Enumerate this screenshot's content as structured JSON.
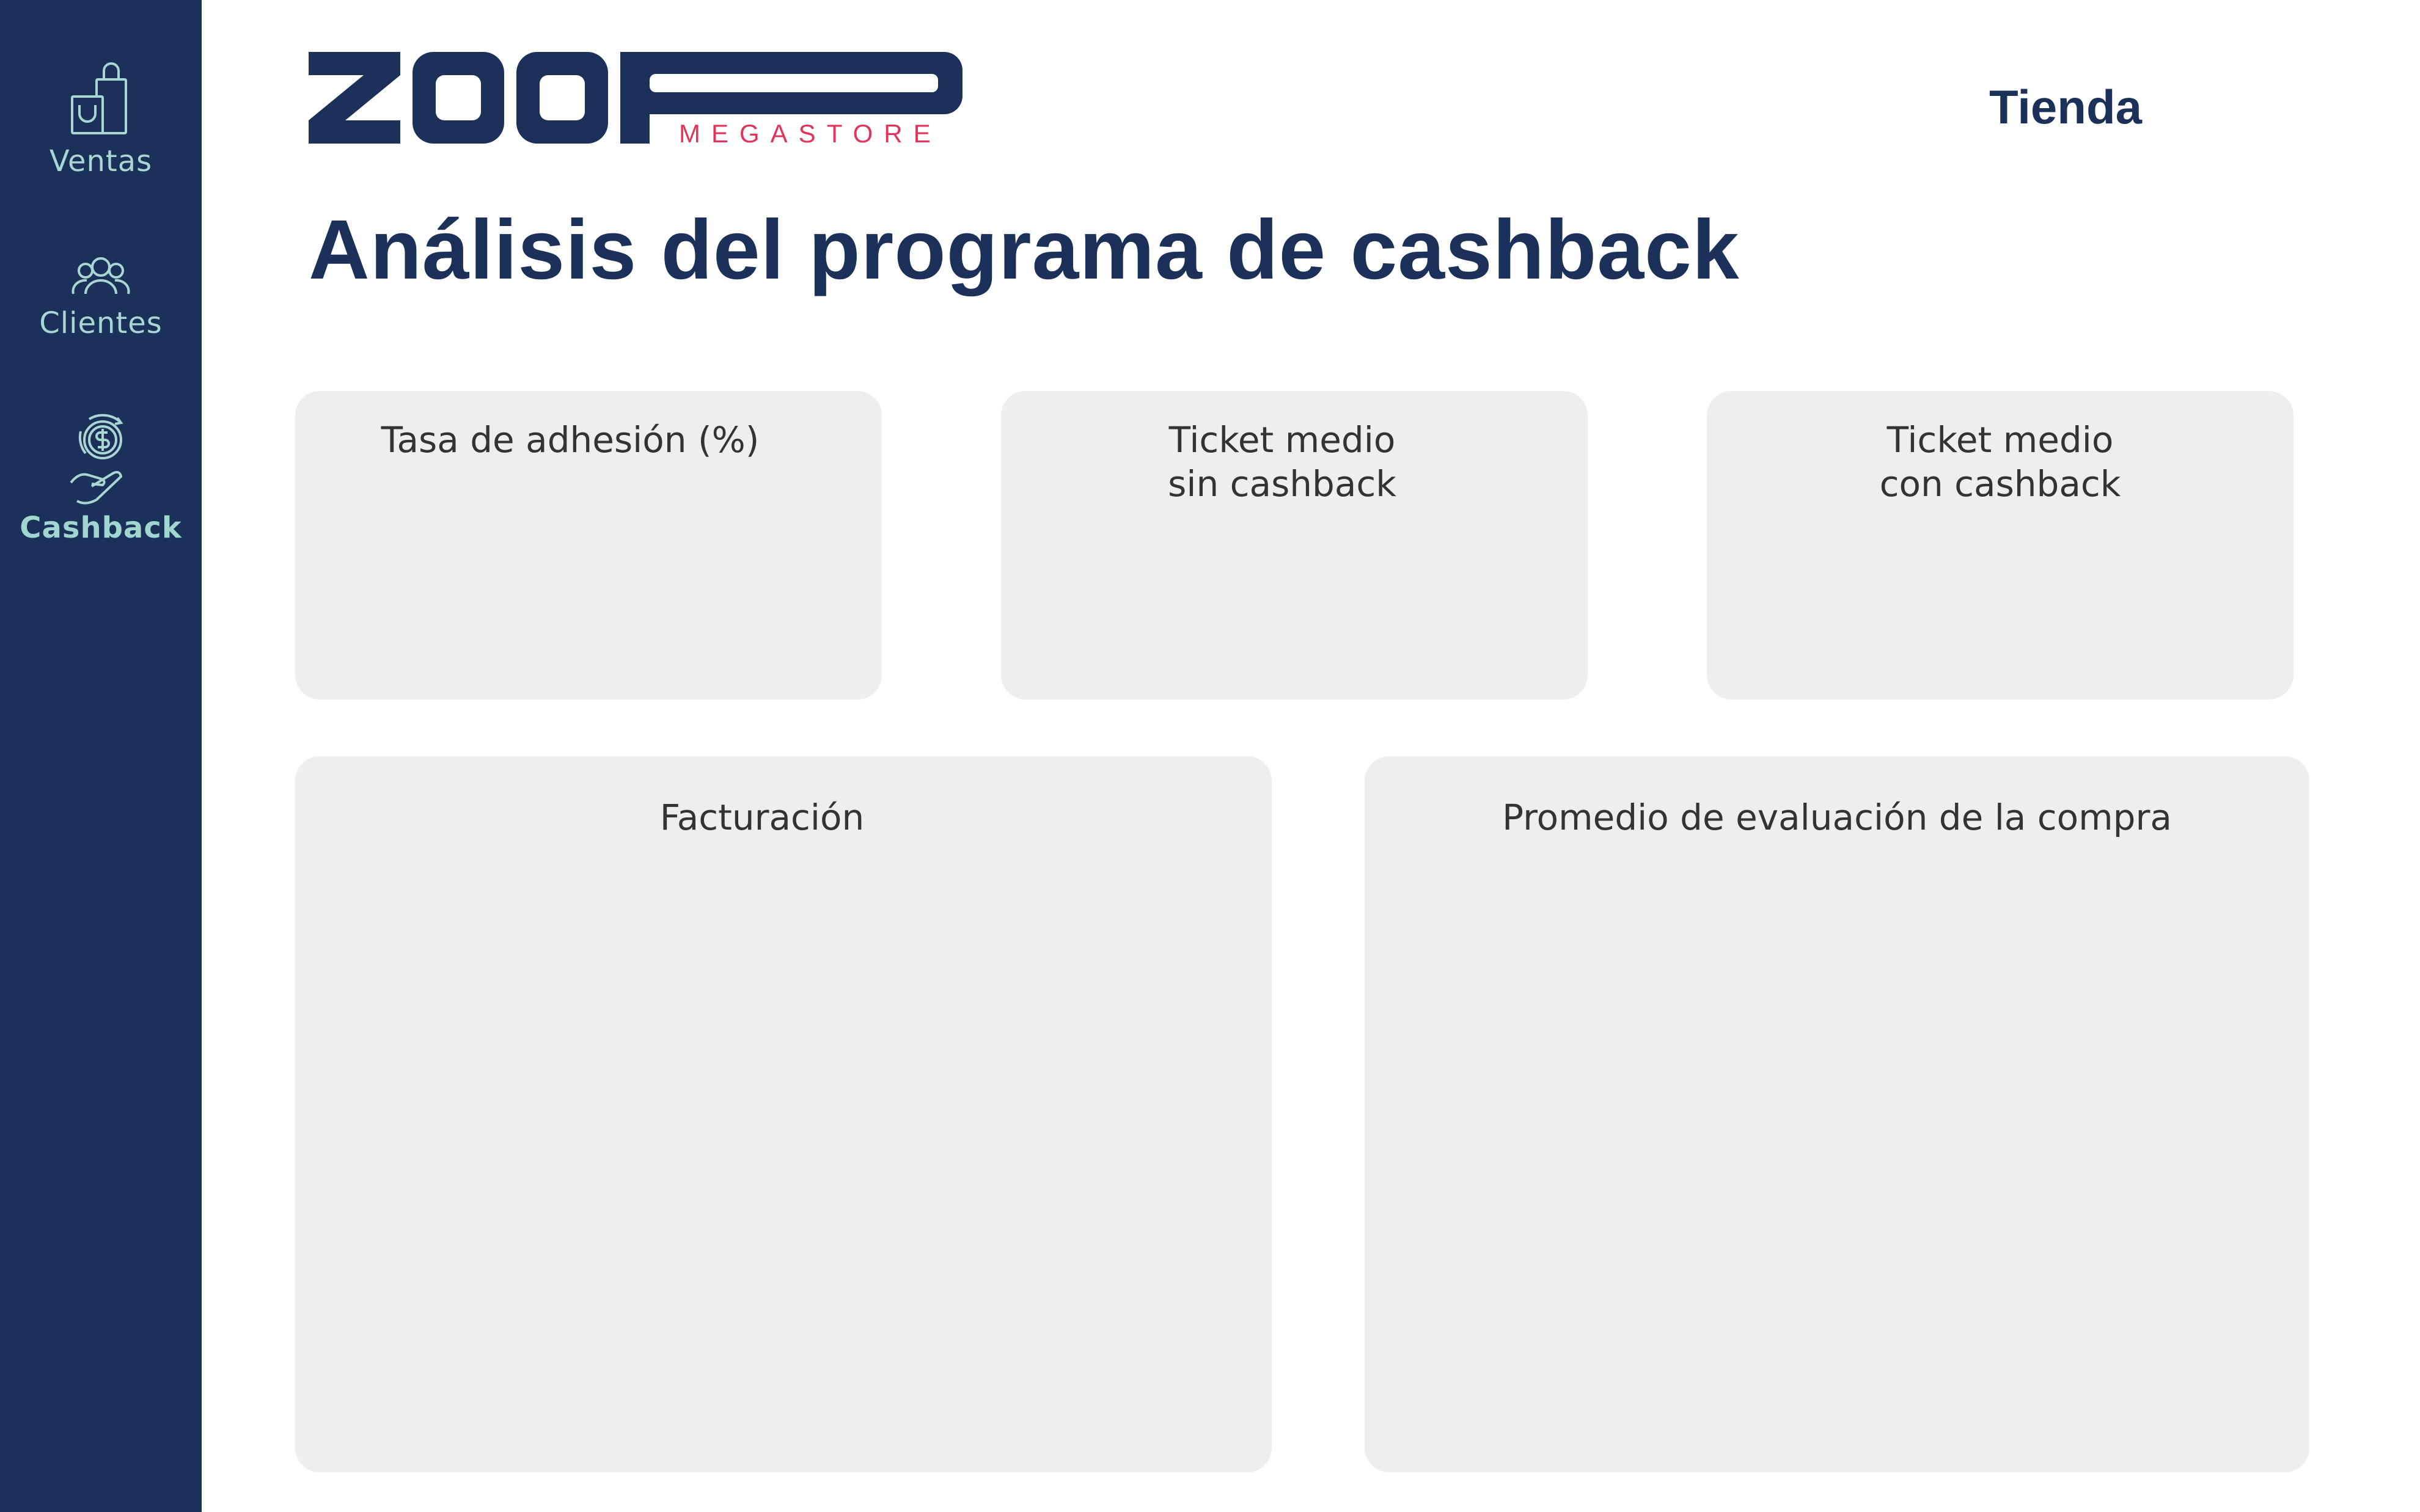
{
  "sidebar": {
    "items": [
      {
        "label": "Ventas",
        "icon": "shopping-bags-icon",
        "active": false
      },
      {
        "label": "Clientes",
        "icon": "users-group-icon",
        "active": false
      },
      {
        "label": "Cashback",
        "icon": "hand-coin-icon",
        "active": true
      }
    ]
  },
  "header": {
    "logo": {
      "wordmark": "ZOOP",
      "tagline": "MEGASTORE"
    },
    "store_label": "Tienda",
    "title": "Análisis del programa de cashback"
  },
  "kpis": [
    {
      "title": "Tasa de adhesión (%)"
    },
    {
      "title": "Ticket medio\nsin cashback"
    },
    {
      "title": "Ticket medio\ncon cashback"
    }
  ],
  "panels": [
    {
      "title": "Facturación"
    },
    {
      "title": "Promedio de evaluación de la compra"
    }
  ],
  "colors": {
    "sidebar_bg": "#1b3159",
    "sidebar_text": "#a9d6d3",
    "brand_navy": "#1b3159",
    "brand_accent": "#e0345a",
    "card_bg": "#eeeeee"
  }
}
